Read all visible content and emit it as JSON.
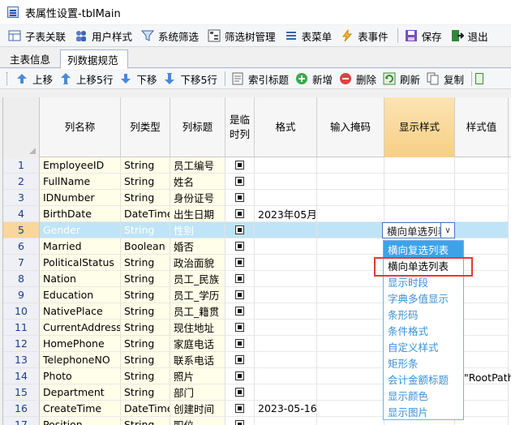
{
  "window": {
    "title": "表属性设置-tblMain"
  },
  "toolbar1": {
    "items": [
      {
        "label": "子表关联",
        "icon": "table-icon"
      },
      {
        "label": "用户样式",
        "icon": "users-icon"
      },
      {
        "label": "系统筛选",
        "icon": "filter-icon"
      },
      {
        "label": "筛选树管理",
        "icon": "tree-icon"
      },
      {
        "label": "表菜单",
        "icon": "menu-icon"
      },
      {
        "label": "表事件",
        "icon": "lightning-icon"
      },
      {
        "label": "保存",
        "icon": "save-icon"
      },
      {
        "label": "退出",
        "icon": "exit-icon"
      }
    ]
  },
  "tabs": [
    {
      "label": "主表信息"
    },
    {
      "label": "列数据规范"
    }
  ],
  "toolbar2": {
    "items": [
      {
        "label": "上移",
        "icon": "arrow-up-icon"
      },
      {
        "label": "上移5行",
        "icon": "arrow-up-double-icon"
      },
      {
        "label": "下移",
        "icon": "arrow-down-icon"
      },
      {
        "label": "下移5行",
        "icon": "arrow-down-double-icon"
      },
      {
        "label": "索引标题",
        "icon": "index-icon"
      },
      {
        "label": "新增",
        "icon": "add-icon"
      },
      {
        "label": "删除",
        "icon": "delete-icon"
      },
      {
        "label": "刷新",
        "icon": "refresh-icon"
      },
      {
        "label": "复制",
        "icon": "copy-icon"
      }
    ]
  },
  "grid": {
    "headers": {
      "col_name": "列名称",
      "col_type": "列类型",
      "col_title": "列标题",
      "is_temp_line1": "是临",
      "is_temp_line2": "时列",
      "format": "格式",
      "input_mask": "输入掩码",
      "display_style": "显示样式",
      "style_value": "样式值"
    },
    "rows": [
      {
        "num": "1",
        "name": "EmployeeID",
        "type": "String",
        "title": "员工编号",
        "format": ""
      },
      {
        "num": "2",
        "name": "FullName",
        "type": "String",
        "title": "姓名",
        "format": ""
      },
      {
        "num": "3",
        "name": "IDNumber",
        "type": "String",
        "title": "身份证号",
        "format": ""
      },
      {
        "num": "4",
        "name": "BirthDate",
        "type": "DateTime",
        "title": "出生日期",
        "format": "2023年05月"
      },
      {
        "num": "5",
        "name": "Gender",
        "type": "String",
        "title": "性别",
        "format": ""
      },
      {
        "num": "6",
        "name": "Married",
        "type": "Boolean",
        "title": "婚否",
        "format": ""
      },
      {
        "num": "7",
        "name": "PoliticalStatus",
        "type": "String",
        "title": "政治面貌",
        "format": ""
      },
      {
        "num": "8",
        "name": "Nation",
        "type": "String",
        "title": "员工_民族",
        "format": ""
      },
      {
        "num": "9",
        "name": "Education",
        "type": "String",
        "title": "员工_学历",
        "format": ""
      },
      {
        "num": "10",
        "name": "NativePlace",
        "type": "String",
        "title": "员工_籍贯",
        "format": ""
      },
      {
        "num": "11",
        "name": "CurrentAddress",
        "type": "String",
        "title": "现住地址",
        "format": ""
      },
      {
        "num": "12",
        "name": "HomePhone",
        "type": "String",
        "title": "家庭电话",
        "format": ""
      },
      {
        "num": "13",
        "name": "TelephoneNO",
        "type": "String",
        "title": "联系电话",
        "format": ""
      },
      {
        "num": "14",
        "name": "Photo",
        "type": "String",
        "title": "照片",
        "format": ""
      },
      {
        "num": "15",
        "name": "Department",
        "type": "String",
        "title": "部门",
        "format": ""
      },
      {
        "num": "16",
        "name": "CreateTime",
        "type": "DateTime",
        "title": "创建时间",
        "format": "2023-05-16"
      },
      {
        "num": "17",
        "name": "Position",
        "type": "String",
        "title": "职位",
        "format": ""
      }
    ],
    "selected_row": 4,
    "row14_style_value": "\"RootPath"
  },
  "combo": {
    "value": "横向单选列表"
  },
  "dropdown": {
    "options": [
      "横向复选列表",
      "横向单选列表",
      "显示时段",
      "字典多值显示",
      "条形码",
      "条件格式",
      "自定义样式",
      "矩形条",
      "会计金额标题",
      "显示颜色",
      "显示图片"
    ]
  },
  "colors": {
    "selected_row": "#bfe4f7",
    "highlight_border": "#e23a3a",
    "header_sort": "#f7cf85",
    "dropdown_text": "#3a90d8"
  }
}
